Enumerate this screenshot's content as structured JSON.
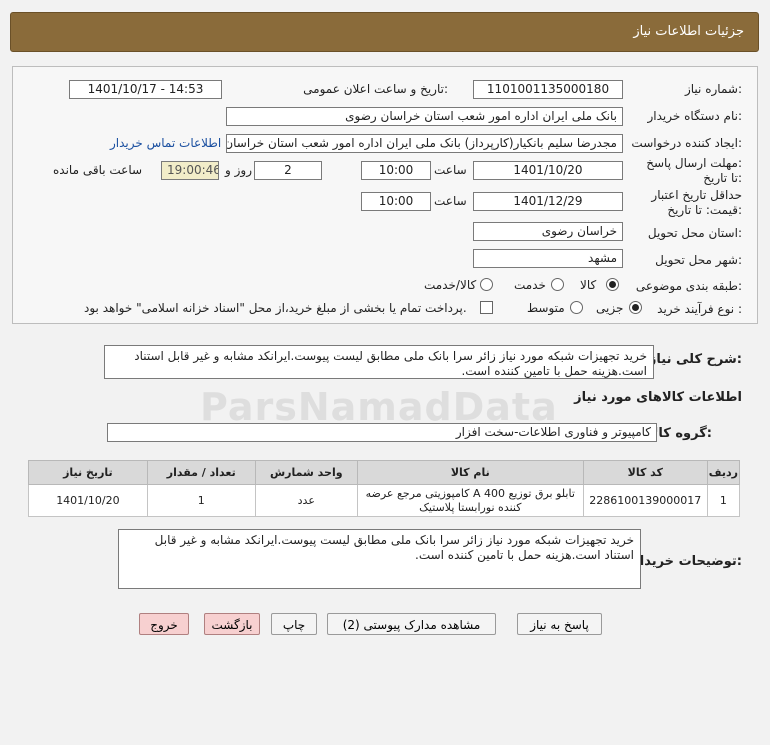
{
  "header": {
    "title": "جزئیات اطلاعات نیاز"
  },
  "form": {
    "need_number": {
      "label": "شماره نیاز:",
      "value": "1101001135000180"
    },
    "announce_datetime": {
      "label": "تاریخ و ساعت اعلان عمومی:",
      "value": "1401/10/17 - 14:53"
    },
    "buyer_org": {
      "label": "نام دستگاه خریدار:",
      "value": "بانک ملی ایران اداره امور شعب استان خراسان رضوی"
    },
    "requester": {
      "label": "ایجاد کننده درخواست:",
      "value": "مجدرضا سلیم  بانکیار(کارپرداز) بانک ملی ایران اداره امور شعب استان خراسان ر",
      "contact_link": "اطلاعات تماس خریدار"
    },
    "send_deadline": {
      "label": "مهلت ارسال پاسخ: تا تاریخ:",
      "date": "1401/10/20",
      "time_label": "ساعت",
      "time": "10:00",
      "days": "2",
      "days_label": "روز و",
      "remaining": "19:00:46",
      "remaining_label": "ساعت باقی مانده"
    },
    "price_validity": {
      "label": "حداقل تاریخ اعتبار قیمت: تا تاریخ:",
      "date": "1401/12/29",
      "time_label": "ساعت",
      "time": "10:00"
    },
    "province": {
      "label": "استان محل تحویل:",
      "value": "خراسان رضوی"
    },
    "city": {
      "label": "شهر محل تحویل:",
      "value": "مشهد"
    },
    "category": {
      "label": "طبقه بندی موضوعی:",
      "options": [
        "کالا",
        "خدمت",
        "کالا/خدمت"
      ],
      "selected": "کالا"
    },
    "process": {
      "label": "نوع فرآیند خرید :",
      "options": [
        "جزیی",
        "متوسط"
      ],
      "selected": "جزیی",
      "payment_note": "پرداخت تمام یا بخشی از مبلغ خرید،از محل \"اسناد خزانه اسلامی\" خواهد بود."
    }
  },
  "description": {
    "label": "شرح کلی نیاز:",
    "value": "خرید تجهیزات شبکه مورد نیاز زائر سرا بانک ملی مطابق لیست پیوست.ایرانکد مشابه و غیر قابل استناد است.هزینه حمل با تامین کننده است."
  },
  "goods_section": {
    "title": "اطلاعات کالاهای مورد نیاز",
    "group_label": "گروه کالا:",
    "group_value": "کامپیوتر و فناوری اطلاعات-سخت افزار"
  },
  "table": {
    "headers": [
      "ردیف",
      "کد کالا",
      "نام کالا",
      "واحد شمارش",
      "تعداد / مقدار",
      "تاریخ نیاز"
    ],
    "rows": [
      [
        "1",
        "2286100139000017",
        "تابلو برق توزیع A 400 کامپوزیتی مرجع عرضه کننده نورابستا پلاستیک",
        "عدد",
        "1",
        "1401/10/20"
      ]
    ]
  },
  "buyer_notes": {
    "label": "توضیحات خریدار:",
    "value": "خرید تجهیزات شبکه مورد نیاز زائر سرا بانک ملی مطابق لیست پیوست.ایرانکد مشابه و غیر قابل استناد است.هزینه حمل با تامین کننده است."
  },
  "buttons": {
    "reply": "پاسخ به نیاز",
    "attachments": "مشاهده مدارک پیوستی (2)",
    "print": "چاپ",
    "back": "بازگشت",
    "exit": "خروج"
  },
  "watermark": "ParsNamadData",
  "colors": {
    "header_bg": "#8a6b3a",
    "link": "#1a4fa0",
    "remaining_bg": "#f2edc9",
    "exit_bg": "#f7d0d0"
  }
}
